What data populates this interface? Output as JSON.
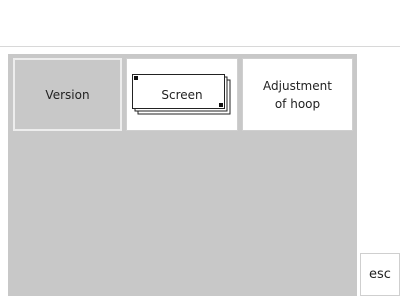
{
  "tabs": {
    "version_label": "Version",
    "screen_label": "Screen",
    "hoop_label": "Adjustment\nof hoop"
  },
  "buttons": {
    "esc_label": "esc"
  },
  "colors": {
    "panel": "#c8c8c8",
    "background": "#ffffff",
    "border": "#cfcfcf"
  }
}
